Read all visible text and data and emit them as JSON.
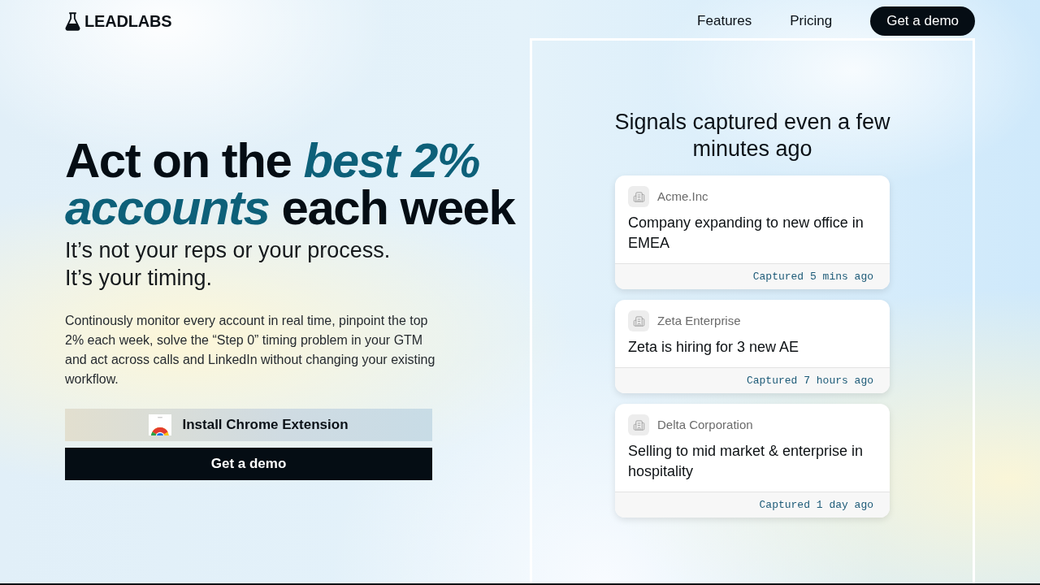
{
  "nav": {
    "logo": "LEADLABS",
    "links": [
      {
        "label": "Features"
      },
      {
        "label": "Pricing"
      }
    ],
    "cta": "Get a demo"
  },
  "hero": {
    "headline": "Act on the *best 2% accounts* each week",
    "subheadline": "It’s not your reps or your process. It’s your timing.",
    "description": "Continously monitor every account in real time, pinpoint the top 2% each week, solve the “Step 0” timing problem in your GTM and act across calls and LinkedIn without changing your existing workflow.",
    "buttons": [
      {
        "kind": "extension",
        "label": "Install Chrome Extension"
      },
      {
        "kind": "primary",
        "label": "Get a demo"
      }
    ]
  },
  "signals_panel": {
    "title": "Signals captured even a few minutes ago",
    "cards": [
      {
        "company": "Acme.Inc",
        "signal": "Company expanding to new office in EMEA",
        "captured": "Captured 5 mins ago"
      },
      {
        "company": "Zeta Enterprise",
        "signal": "Zeta is hiring for 3 new AE",
        "captured": "Captured 7 hours ago"
      },
      {
        "company": "Delta Corporation",
        "signal": "Selling to mid market & enterprise in hospitality",
        "captured": "Captured 1 day ago"
      }
    ]
  }
}
